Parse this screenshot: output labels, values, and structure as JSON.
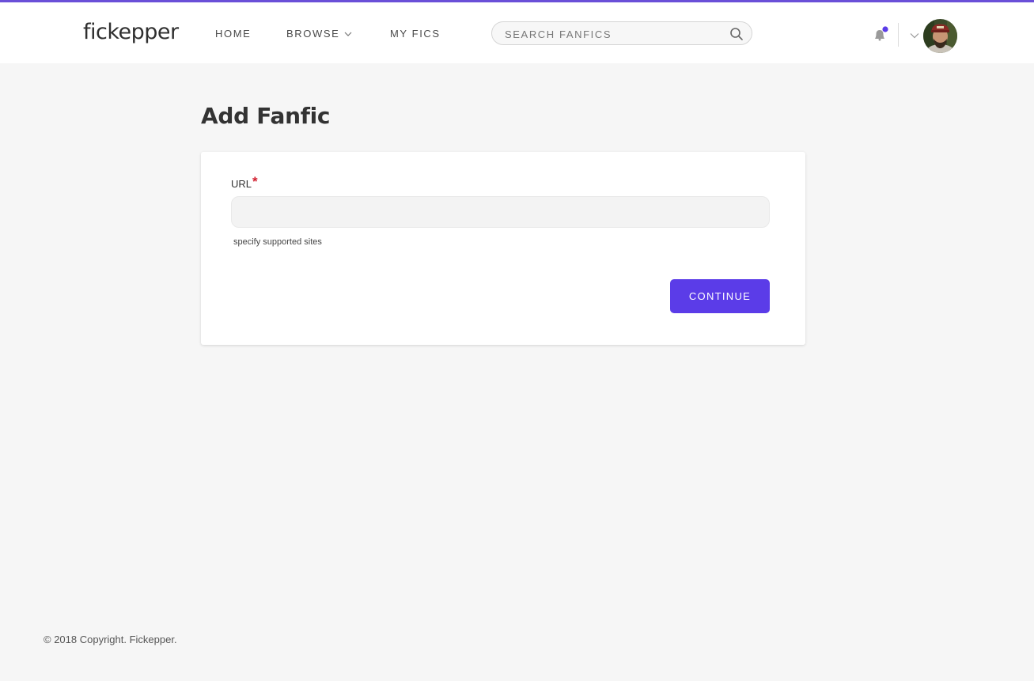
{
  "brand": {
    "logo_text": "fickepper",
    "accent": "#5b3ce8"
  },
  "nav": {
    "home": "HOME",
    "browse": "BROWSE",
    "my_fics": "MY FICS"
  },
  "search": {
    "placeholder": "SEARCH FANFICS",
    "value": ""
  },
  "user_menu": {
    "notification_dot": true
  },
  "page": {
    "title": "Add Fanfic"
  },
  "form": {
    "url_label": "URL",
    "required_mark": "*",
    "url_value": "",
    "help_text": "specify supported sites",
    "continue_label": "CONTINUE"
  },
  "footer": {
    "copyright": "© 2018 Copyright. Fickepper."
  }
}
